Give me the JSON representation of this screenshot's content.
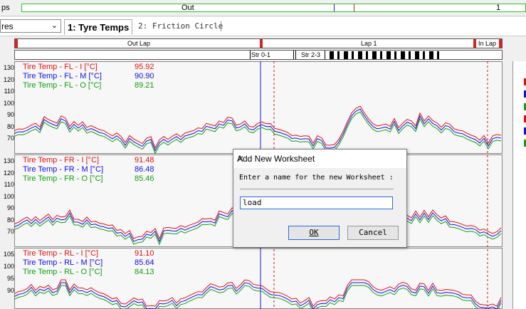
{
  "topbar": {
    "left_label": "ps",
    "mid_label": "Out",
    "right_label": "1"
  },
  "toolbar": {
    "combo_value": "res",
    "tab1": "1: Tyre Temps",
    "tab2": "2: Friction Circle"
  },
  "laps": {
    "out": "Out Lap",
    "lap1": "Lap 1",
    "in": "In Lap"
  },
  "sectors": {
    "s1": "Str 0-1",
    "s2": "Str 2-3"
  },
  "panes": [
    {
      "ticks": [
        "130",
        "120",
        "110",
        "100",
        "90",
        "80",
        "70"
      ],
      "legend": [
        {
          "name": "Tire Temp - FL - I [°C]",
          "value": "95.92",
          "color": "#e01010"
        },
        {
          "name": "Tire Temp - FL - M [°C]",
          "value": "90.90",
          "color": "#1010e0"
        },
        {
          "name": "Tire Temp - FL - O [°C]",
          "value": "89.21",
          "color": "#10a010"
        }
      ]
    },
    {
      "ticks": [
        "130",
        "120",
        "110",
        "100",
        "90",
        "80",
        "70"
      ],
      "legend": [
        {
          "name": "Tire Temp - FR - I [°C]",
          "value": "91.48",
          "color": "#e01010"
        },
        {
          "name": "Tire Temp - FR - M [°C]",
          "value": "86.48",
          "color": "#1010e0"
        },
        {
          "name": "Tire Temp - FR - O [°C]",
          "value": "85.46",
          "color": "#10a010"
        }
      ]
    },
    {
      "ticks": [
        "105",
        "100",
        "95",
        "90"
      ],
      "legend": [
        {
          "name": "Tire Temp - RL - I [°C]",
          "value": "91.10",
          "color": "#e01010"
        },
        {
          "name": "Tire Temp - RL - M [°C]",
          "value": "85.64",
          "color": "#1010e0"
        },
        {
          "name": "Tire Temp - RL - O [°C]",
          "value": "84.13",
          "color": "#10a010"
        }
      ]
    }
  ],
  "dialog": {
    "title": "Add New Worksheet",
    "prompt": "Enter a name for the new Worksheet :",
    "input_value": "load",
    "ok": "OK",
    "cancel": "Cancel",
    "close": "✕"
  },
  "colors": {
    "red": "#e01010",
    "blue": "#1010e0",
    "green": "#10a010"
  }
}
